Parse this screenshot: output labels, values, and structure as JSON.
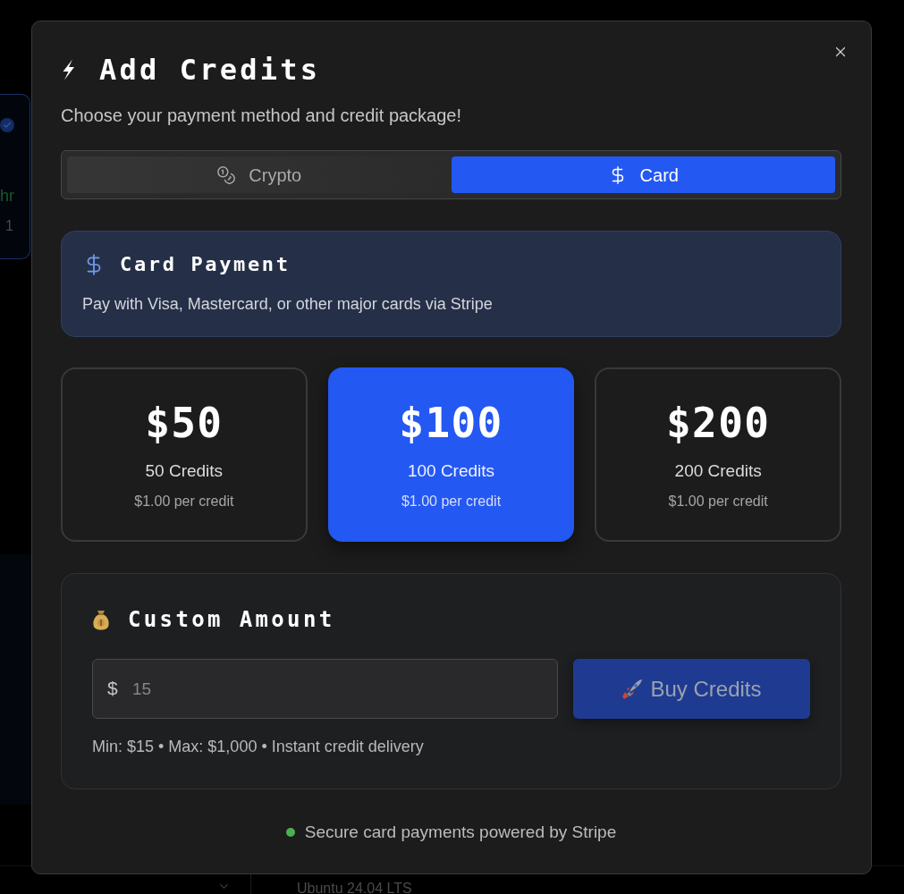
{
  "background": {
    "card_label": "hr",
    "card_count": "1",
    "bottom_label": "Ubuntu 24.04 LTS"
  },
  "dialog": {
    "title": "Add Credits",
    "subtitle": "Choose your payment method and credit package!",
    "tabs": [
      {
        "kind": "crypto",
        "label": "Crypto",
        "selected": false
      },
      {
        "kind": "card",
        "label": "Card",
        "selected": true
      }
    ],
    "method_panel": {
      "title": "Card Payment",
      "description": "Pay with Visa, Mastercard, or other major cards via Stripe"
    },
    "packages": [
      {
        "amount": "$50",
        "credits": "50 Credits",
        "rate": "$1.00 per credit",
        "selected": false
      },
      {
        "amount": "$100",
        "credits": "100 Credits",
        "rate": "$1.00 per credit",
        "selected": true
      },
      {
        "amount": "$200",
        "credits": "200 Credits",
        "rate": "$1.00 per credit",
        "selected": false
      }
    ],
    "custom_amount": {
      "title": "Custom Amount",
      "currency": "$",
      "placeholder": "15",
      "button": {
        "label": "Buy Credits",
        "disabled": true
      },
      "note": "Min: $15 • Max: $1,000 • Instant credit delivery"
    },
    "footer": {
      "text": "Secure card payments powered by Stripe"
    }
  }
}
